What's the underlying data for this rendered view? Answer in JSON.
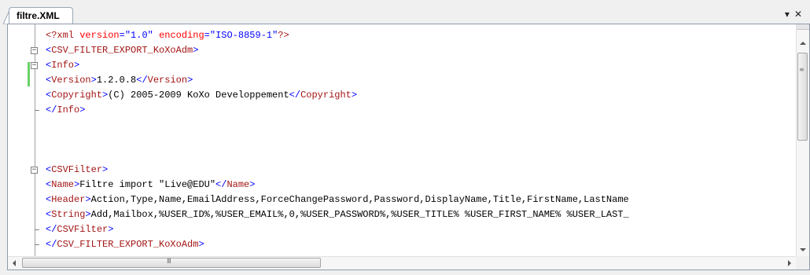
{
  "tab": {
    "title": "filtre.XML",
    "dropdown_glyph": "▾",
    "close_glyph": "✕"
  },
  "editor": {
    "lines": [
      {
        "fold": "",
        "parts": [
          {
            "c": "pi",
            "t": "<?xml "
          },
          {
            "c": "attr",
            "t": "version"
          },
          {
            "c": "blue",
            "t": "=\""
          },
          {
            "c": "val",
            "t": "1.0"
          },
          {
            "c": "blue",
            "t": "\" "
          },
          {
            "c": "attr",
            "t": "encoding"
          },
          {
            "c": "blue",
            "t": "=\""
          },
          {
            "c": "val",
            "t": "ISO-8859-1"
          },
          {
            "c": "blue",
            "t": "\""
          },
          {
            "c": "pi",
            "t": "?>"
          }
        ]
      },
      {
        "fold": "minus",
        "parts": [
          {
            "c": "blue",
            "t": "<"
          },
          {
            "c": "red",
            "t": "CSV_FILTER_EXPORT_KoXoAdm"
          },
          {
            "c": "blue",
            "t": ">"
          }
        ]
      },
      {
        "fold": "minus",
        "parts": [
          {
            "c": "blue",
            "t": "<"
          },
          {
            "c": "red",
            "t": "Info"
          },
          {
            "c": "blue",
            "t": ">"
          }
        ]
      },
      {
        "fold": "",
        "changed": true,
        "parts": [
          {
            "c": "blue",
            "t": "<"
          },
          {
            "c": "red",
            "t": "Version"
          },
          {
            "c": "blue",
            "t": ">"
          },
          {
            "c": "text",
            "t": "1.2.0.8"
          },
          {
            "c": "blue",
            "t": "</"
          },
          {
            "c": "red",
            "t": "Version"
          },
          {
            "c": "blue",
            "t": ">"
          }
        ]
      },
      {
        "fold": "",
        "parts": [
          {
            "c": "blue",
            "t": "<"
          },
          {
            "c": "red",
            "t": "Copyright"
          },
          {
            "c": "blue",
            "t": ">"
          },
          {
            "c": "text",
            "t": "(C) 2005-2009 KoXo Developpement"
          },
          {
            "c": "blue",
            "t": "</"
          },
          {
            "c": "red",
            "t": "Copyright"
          },
          {
            "c": "blue",
            "t": ">"
          }
        ]
      },
      {
        "fold": "end",
        "parts": [
          {
            "c": "blue",
            "t": "</"
          },
          {
            "c": "red",
            "t": "Info"
          },
          {
            "c": "blue",
            "t": ">"
          }
        ]
      },
      {
        "fold": "",
        "parts": []
      },
      {
        "fold": "",
        "parts": []
      },
      {
        "fold": "",
        "parts": []
      },
      {
        "fold": "minus",
        "parts": [
          {
            "c": "blue",
            "t": "<"
          },
          {
            "c": "red",
            "t": "CSVFilter"
          },
          {
            "c": "blue",
            "t": ">"
          }
        ]
      },
      {
        "fold": "",
        "parts": [
          {
            "c": "blue",
            "t": "<"
          },
          {
            "c": "red",
            "t": "Name"
          },
          {
            "c": "blue",
            "t": ">"
          },
          {
            "c": "text",
            "t": "Filtre import \"Live@EDU\""
          },
          {
            "c": "blue",
            "t": "</"
          },
          {
            "c": "red",
            "t": "Name"
          },
          {
            "c": "blue",
            "t": ">"
          }
        ]
      },
      {
        "fold": "",
        "parts": [
          {
            "c": "blue",
            "t": "<"
          },
          {
            "c": "red",
            "t": "Header"
          },
          {
            "c": "blue",
            "t": ">"
          },
          {
            "c": "text",
            "t": "Action,Type,Name,EmailAddress,ForceChangePassword,Password,DisplayName,Title,FirstName,LastName"
          }
        ]
      },
      {
        "fold": "",
        "parts": [
          {
            "c": "blue",
            "t": "<"
          },
          {
            "c": "red",
            "t": "String"
          },
          {
            "c": "blue",
            "t": ">"
          },
          {
            "c": "text",
            "t": "Add,Mailbox,%USER_ID%,%USER_EMAIL%,0,%USER_PASSWORD%,%USER_TITLE% %USER_FIRST_NAME% %USER_LAST_"
          }
        ]
      },
      {
        "fold": "end",
        "parts": [
          {
            "c": "blue",
            "t": "</"
          },
          {
            "c": "red",
            "t": "CSVFilter"
          },
          {
            "c": "blue",
            "t": ">"
          }
        ]
      },
      {
        "fold": "end",
        "parts": [
          {
            "c": "blue",
            "t": "</"
          },
          {
            "c": "red",
            "t": "CSV_FILTER_EXPORT_KoXoAdm"
          },
          {
            "c": "blue",
            "t": ">"
          }
        ]
      }
    ]
  },
  "scrollbars": {
    "vertical_grip": "≡",
    "horizontal_grip": "III"
  },
  "icons": {
    "fold_minus": "minus-box-icon",
    "scroll_up": "arrow-up-icon",
    "scroll_down": "arrow-down-icon",
    "scroll_left": "arrow-left-icon",
    "scroll_right": "arrow-right-icon"
  }
}
